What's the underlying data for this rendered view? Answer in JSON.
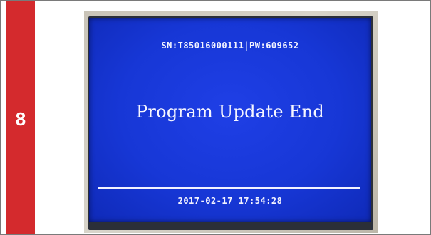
{
  "step": {
    "number": "8",
    "color": "#d42a2d"
  },
  "device_screen": {
    "background_color": "#1737d6",
    "sn_line": "SN:T85016000111|PW:609652",
    "message": "Program Update End",
    "datetime": "2017-02-17 17:54:28"
  }
}
